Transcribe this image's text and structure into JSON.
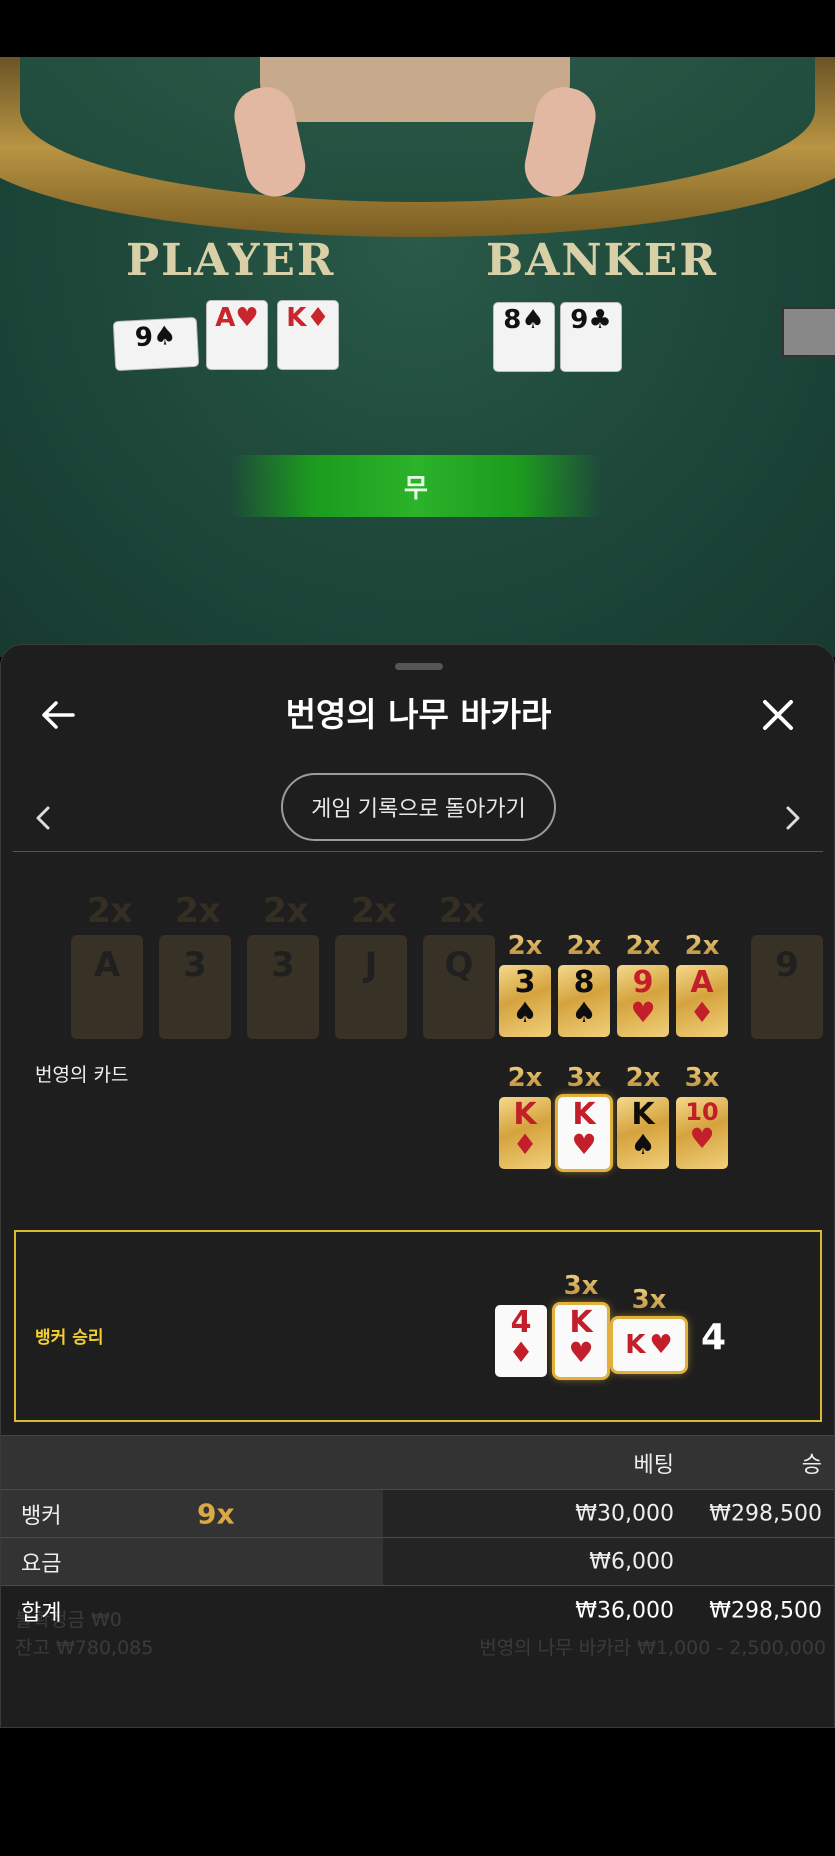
{
  "table": {
    "player_label": "PLAYER",
    "banker_label": "BANKER",
    "result_text": "무",
    "player_cards": [
      {
        "rank": "9",
        "suit": "♠",
        "color": "blk",
        "sideways": true
      },
      {
        "rank": "A",
        "suit": "♥",
        "color": "red",
        "sideways": false
      },
      {
        "rank": "K",
        "suit": "♦",
        "color": "red",
        "sideways": false
      }
    ],
    "banker_cards": [
      {
        "rank": "8",
        "suit": "♠",
        "color": "blk",
        "sideways": false
      },
      {
        "rank": "9",
        "suit": "♣",
        "color": "blk",
        "sideways": false
      }
    ]
  },
  "sheet": {
    "title": "번영의 나무 바카라",
    "history_button": "게임 기록으로 돌아가기",
    "back_icon": "arrow-left-icon",
    "close_icon": "close-icon",
    "prev_icon": "chevron-left-icon",
    "next_icon": "chevron-right-icon"
  },
  "lucky_cards": {
    "label": "번영의 카드",
    "rows": [
      [
        {
          "mult": "2x",
          "rank": "3",
          "suit": "♠",
          "color": "blk"
        },
        {
          "mult": "2x",
          "rank": "8",
          "suit": "♠",
          "color": "blk"
        },
        {
          "mult": "2x",
          "rank": "9",
          "suit": "♥",
          "color": "red"
        },
        {
          "mult": "2x",
          "rank": "A",
          "suit": "♦",
          "color": "red"
        }
      ],
      [
        {
          "mult": "2x",
          "rank": "K",
          "suit": "♦",
          "color": "red",
          "hl": false
        },
        {
          "mult": "3x",
          "rank": "K",
          "suit": "♥",
          "color": "red",
          "hl": true
        },
        {
          "mult": "2x",
          "rank": "K",
          "suit": "♠",
          "color": "blk",
          "hl": false
        },
        {
          "mult": "3x",
          "rank": "10",
          "suit": "♥",
          "color": "red",
          "hl": false
        }
      ]
    ]
  },
  "winning_hand": {
    "label": "뱅커 승리",
    "cards": [
      {
        "mult": "",
        "rank": "4",
        "suit": "♦",
        "color": "red"
      },
      {
        "mult": "3x",
        "rank": "K",
        "suit": "♥",
        "color": "red"
      }
    ],
    "side_card": {
      "mult": "3x",
      "rank": "K",
      "suit": "♥"
    },
    "total": "4"
  },
  "bets": {
    "headers": {
      "bet": "베팅",
      "win": "승"
    },
    "rows": [
      {
        "name": "뱅커",
        "mult": "9x",
        "bet": "₩30,000",
        "win": "₩298,500"
      },
      {
        "name": "요금",
        "mult": "",
        "bet": "₩6,000",
        "win": ""
      }
    ],
    "total": {
      "name": "합계",
      "bet": "₩36,000",
      "win": "₩298,500"
    }
  },
  "footer_ghost": {
    "left1": "불확정금 ₩0",
    "left2": "잔고 ₩780,085",
    "right": "번영의 나무 바카라 ₩1,000 - 2,500,000"
  }
}
